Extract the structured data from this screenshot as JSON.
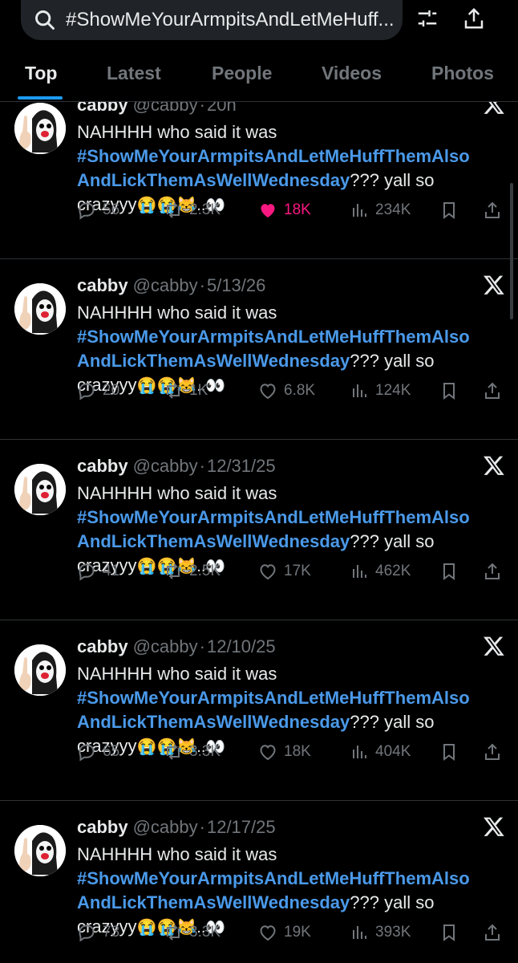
{
  "search": {
    "query": "#ShowMeYourArmpitsAndLetMeHuff..."
  },
  "header": {
    "filter_icon": "filter-icon",
    "share_icon": "share-icon"
  },
  "tabs": [
    {
      "label": "Top",
      "active": true
    },
    {
      "label": "Latest",
      "active": false
    },
    {
      "label": "People",
      "active": false
    },
    {
      "label": "Videos",
      "active": false
    },
    {
      "label": "Photos",
      "active": false
    }
  ],
  "tweets": [
    {
      "name": "cabby",
      "handle": "@cabby",
      "date": "20h",
      "text_start": "NAHHHH who said it was",
      "hashtag_1": "#ShowMeYourArmpitsAndLetMeHuffThemAlso",
      "hashtag_2": "AndLickThemAsWellWednesday",
      "text_after": "??? yall so",
      "text_end": "crazyyy",
      "emojis": "😭😭😹..👀",
      "replies": "56",
      "reposts": "2.3K",
      "likes": "18K",
      "views": "234K",
      "liked": true
    },
    {
      "name": "cabby",
      "handle": "@cabby",
      "date": "5/13/26",
      "text_start": "NAHHHH who said it was",
      "hashtag_1": "#ShowMeYourArmpitsAndLetMeHuffThemAlso",
      "hashtag_2": "AndLickThemAsWellWednesday",
      "text_after": "??? yall so",
      "text_end": "crazyyy",
      "emojis": "😭😭😹..👀",
      "replies": "20",
      "reposts": "1K",
      "likes": "6.8K",
      "views": "124K",
      "liked": false
    },
    {
      "name": "cabby",
      "handle": "@cabby",
      "date": "12/31/25",
      "text_start": "NAHHHH who said it was",
      "hashtag_1": "#ShowMeYourArmpitsAndLetMeHuffThemAlso",
      "hashtag_2": "AndLickThemAsWellWednesday",
      "text_after": "??? yall so",
      "text_end": "crazyyy",
      "emojis": "😭😭😹..👀",
      "replies": "41",
      "reposts": "2.5K",
      "likes": "17K",
      "views": "462K",
      "liked": false
    },
    {
      "name": "cabby",
      "handle": "@cabby",
      "date": "12/10/25",
      "text_start": "NAHHHH who said it was",
      "hashtag_1": "#ShowMeYourArmpitsAndLetMeHuffThemAlso",
      "hashtag_2": "AndLickThemAsWellWednesday",
      "text_after": "??? yall so",
      "text_end": "crazyyy",
      "emojis": "😭😭😹..👀",
      "replies": "65",
      "reposts": "3.3K",
      "likes": "18K",
      "views": "404K",
      "liked": false
    },
    {
      "name": "cabby",
      "handle": "@cabby",
      "date": "12/17/25",
      "text_start": "NAHHHH who said it was",
      "hashtag_1": "#ShowMeYourArmpitsAndLetMeHuffThemAlso",
      "hashtag_2": "AndLickThemAsWellWednesday",
      "text_after": "??? yall so",
      "text_end": "crazyyy",
      "emojis": "😭😭😹..👀",
      "replies": "73",
      "reposts": "3.3K",
      "likes": "19K",
      "views": "393K",
      "liked": false
    }
  ],
  "colors": {
    "background": "#000000",
    "hashtag": "#4a99e9",
    "muted": "#71767b",
    "like_active": "#f91880",
    "accent": "#1d9bf0"
  }
}
